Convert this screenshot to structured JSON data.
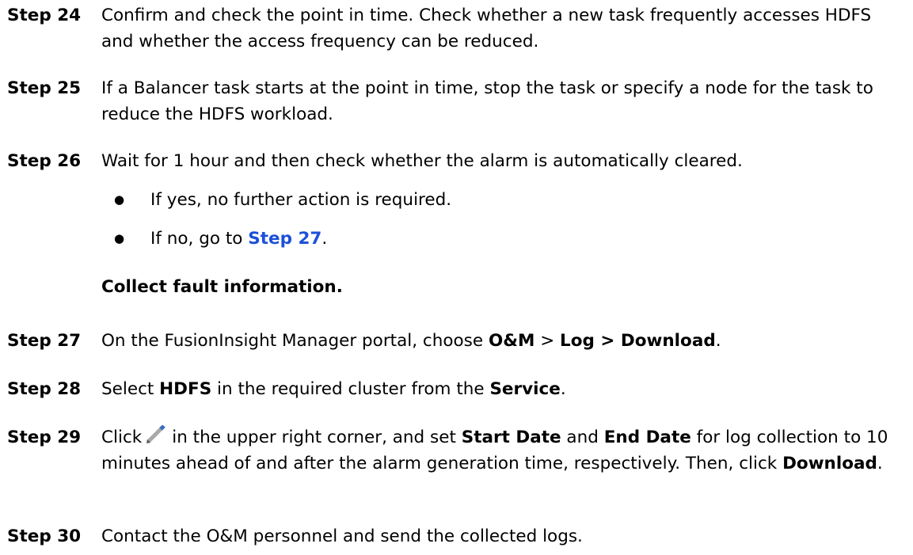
{
  "steps": {
    "s24": {
      "label": "Step 24",
      "text": "Confirm and check the point in time. Check whether a new task frequently accesses HDFS and whether the access frequency can be reduced."
    },
    "s25": {
      "label": "Step 25",
      "text": "If a Balancer task starts at the point in time, stop the task or specify a node for the task to reduce the HDFS workload."
    },
    "s26": {
      "label": "Step 26",
      "text": "Wait for 1 hour and then check whether the alarm is automatically cleared.",
      "bullets": {
        "b1": {
          "symbol": "●",
          "text": "If yes, no further action is required."
        },
        "b2": {
          "symbol": "●",
          "pre": "If no, go to ",
          "link": "Step 27",
          "post": "."
        }
      }
    },
    "section_heading": "Collect fault information.",
    "s27": {
      "label": "Step 27",
      "pre": "On the FusionInsight Manager portal, choose ",
      "b1": "O&M",
      "mid": " > ",
      "b2": "Log > Download",
      "post": "."
    },
    "s28": {
      "label": "Step 28",
      "pre": "Select ",
      "b1": "HDFS",
      "mid": " in the required cluster from the ",
      "b2": "Service",
      "post": "."
    },
    "s29": {
      "label": "Step 29",
      "t1": "Click",
      "t2": "in the upper right corner, and set ",
      "b1": "Start Date",
      "t3": " and ",
      "b2": "End Date",
      "t4": " for log collection to 10 minutes ahead of and after the alarm generation time, respectively. Then, click ",
      "b3": "Download",
      "t5": ".",
      "icon": "pencil-edit-icon"
    },
    "s30": {
      "label": "Step 30",
      "text": "Contact the O&M personnel and send the collected logs."
    }
  }
}
